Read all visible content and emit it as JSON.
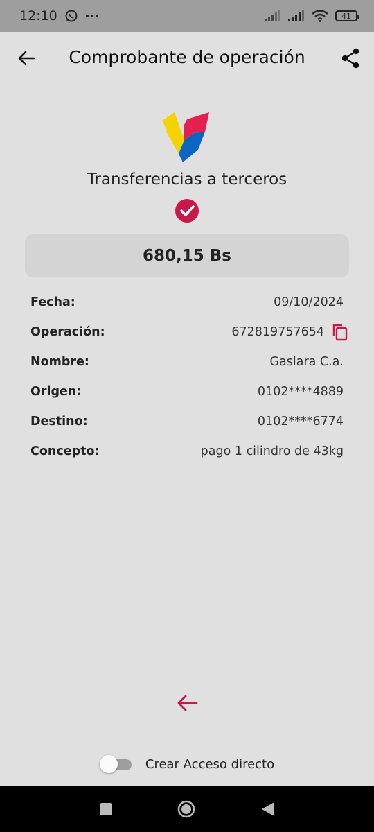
{
  "status": {
    "time": "12:10",
    "battery": "41"
  },
  "header": {
    "title": "Comprobante de operación"
  },
  "receipt": {
    "operation_type": "Transferencias a terceros",
    "amount": "680,15 Bs",
    "details": [
      {
        "label": "Fecha:",
        "value": "09/10/2024"
      },
      {
        "label": "Operación:",
        "value": "672819757654"
      },
      {
        "label": "Nombre:",
        "value": "Gaslara C.a."
      },
      {
        "label": "Origen:",
        "value": "0102****4889"
      },
      {
        "label": "Destino:",
        "value": "0102****6774"
      },
      {
        "label": "Concepto:",
        "value": "pago 1 cilindro de 43kg"
      }
    ]
  },
  "footer": {
    "shortcut_label": "Crear Acceso directo",
    "shortcut_enabled": false
  },
  "colors": {
    "accent": "#c8194a",
    "logo_yellow": "#f5d300",
    "logo_red": "#e3204f",
    "logo_blue": "#0a66c2"
  },
  "icons": [
    "whatsapp-icon",
    "more-icon",
    "signal-icon",
    "wifi-icon",
    "battery-icon",
    "back-arrow-icon",
    "share-icon",
    "bank-logo",
    "check-icon",
    "copy-icon",
    "back-arrow-icon",
    "square-icon",
    "circle-icon",
    "triangle-icon"
  ]
}
